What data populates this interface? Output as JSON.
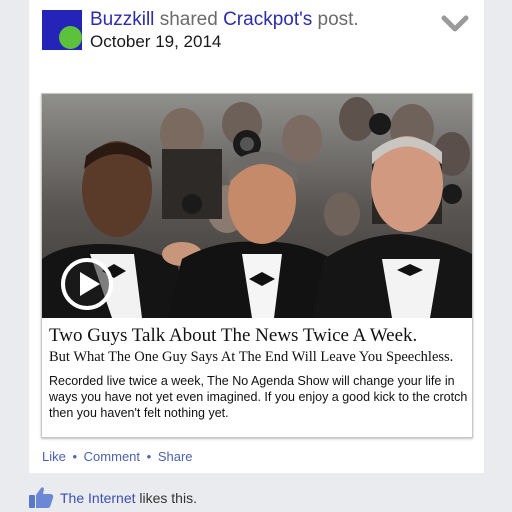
{
  "post": {
    "sharer": "Buzzkill",
    "shared_text": "shared",
    "owner": "Crackpot's",
    "post_word": "post.",
    "date": "October 19, 2014"
  },
  "attachment": {
    "headline": "Two Guys Talk About The News Twice A Week.",
    "subheadline": "But What The One Guy Says At The End Will Leave You Speechless.",
    "description": "Recorded live twice a week, The No Agenda Show will change your life in ways you have not yet even imagined.  If you enjoy a good kick to the crotch then you haven't felt nothing yet."
  },
  "actions": {
    "like": "Like",
    "comment": "Comment",
    "share": "Share",
    "separator": "•"
  },
  "likes": {
    "who": "The Internet",
    "text": "likes this."
  },
  "colors": {
    "link": "#2d2dab",
    "action_link": "#4a62b0",
    "avatar_bg": "#2424b8",
    "avatar_dot": "#5cc23c",
    "page_bg": "#e9ebee"
  },
  "icons": {
    "menu": "chevron-down-icon",
    "video": "play-icon",
    "like": "thumbs-up-icon"
  }
}
